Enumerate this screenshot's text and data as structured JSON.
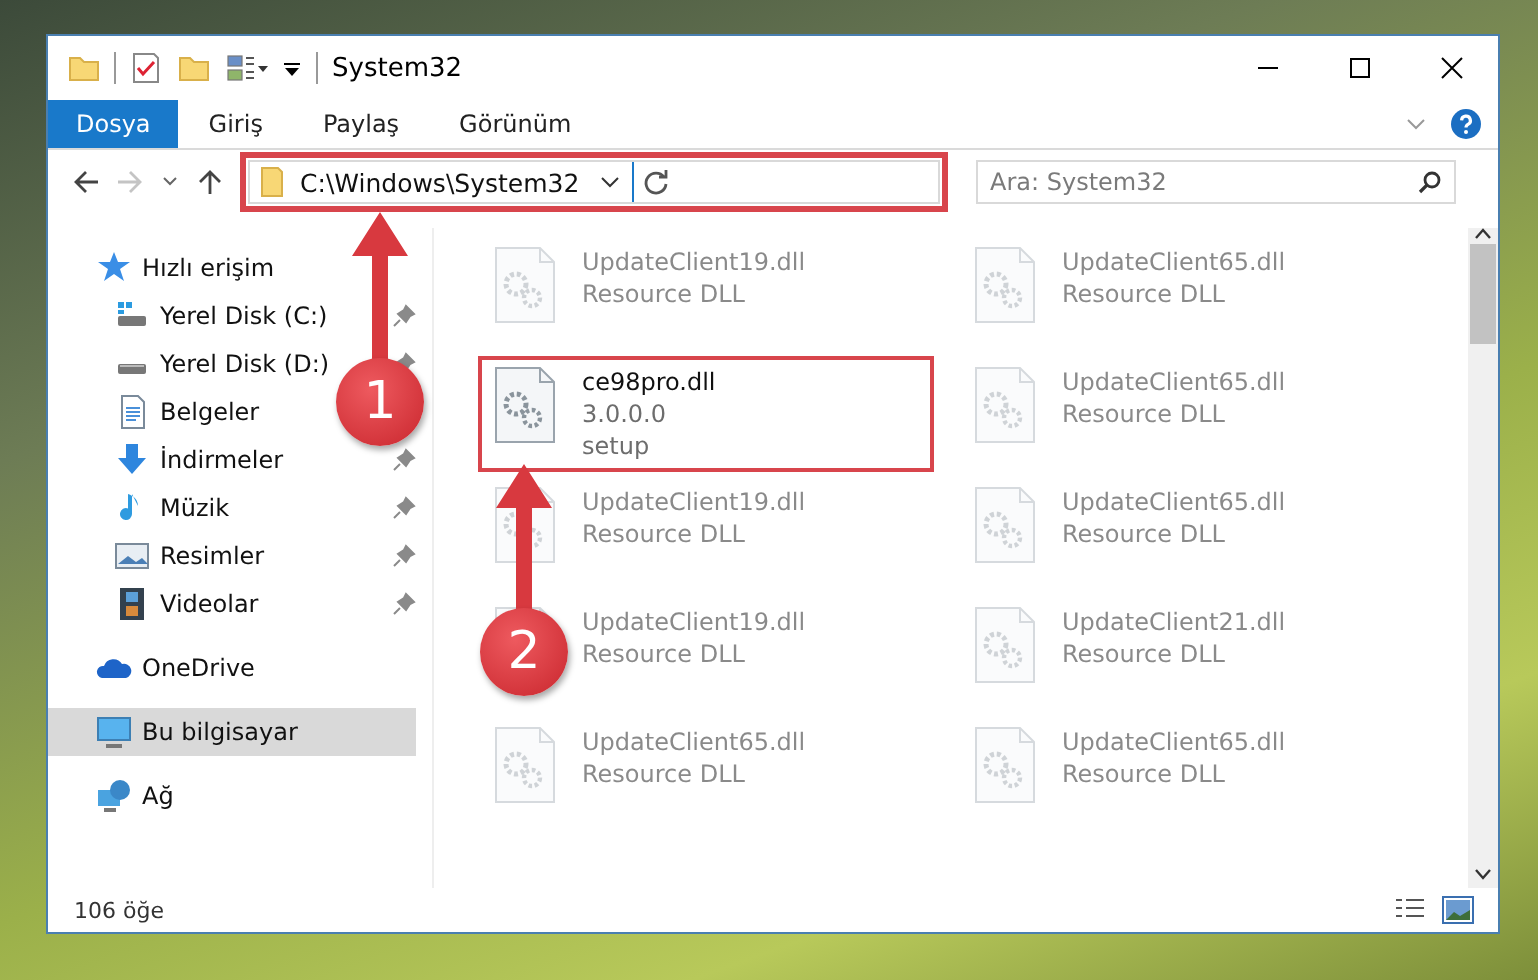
{
  "window": {
    "title": "System32"
  },
  "ribbon": {
    "tabs": [
      {
        "label": "Dosya",
        "selected": true
      },
      {
        "label": "Giriş",
        "selected": false
      },
      {
        "label": "Paylaş",
        "selected": false
      },
      {
        "label": "Görünüm",
        "selected": false
      }
    ]
  },
  "address_bar": {
    "path": "C:\\Windows\\System32",
    "highlighted": true
  },
  "search": {
    "placeholder": "Ara: System32"
  },
  "navigation": {
    "items": [
      {
        "label": "Hızlı erişim",
        "kind": "star",
        "selected": false,
        "children": [
          {
            "label": "Yerel Disk (C:)",
            "kind": "system-drive",
            "selected": false,
            "pinned": true
          },
          {
            "label": "Yerel Disk (D:)",
            "kind": "drive",
            "selected": false,
            "pinned": true
          },
          {
            "label": "Belgeler",
            "kind": "documents",
            "selected": false,
            "pinned": false
          },
          {
            "label": "İndirmeler",
            "kind": "downloads",
            "selected": false,
            "pinned": true
          },
          {
            "label": "Müzik",
            "kind": "music",
            "selected": false,
            "pinned": true
          },
          {
            "label": "Resimler",
            "kind": "pictures",
            "selected": false,
            "pinned": true
          },
          {
            "label": "Videolar",
            "kind": "videos",
            "selected": false,
            "pinned": true
          }
        ]
      },
      {
        "label": "OneDrive",
        "kind": "cloud",
        "selected": false
      },
      {
        "label": "Bu bilgisayar",
        "kind": "computer",
        "selected": true
      },
      {
        "label": "Ağ",
        "kind": "network",
        "selected": false
      }
    ]
  },
  "files": [
    {
      "name": "UpdateClient19.dll",
      "lines": [
        "Resource DLL"
      ],
      "faded": true,
      "highlighted": false
    },
    {
      "name": "UpdateClient65.dll",
      "lines": [
        "Resource DLL"
      ],
      "faded": true,
      "highlighted": false
    },
    {
      "name": "ce98pro.dll",
      "lines": [
        "3.0.0.0",
        "setup"
      ],
      "faded": false,
      "highlighted": true
    },
    {
      "name": "UpdateClient65.dll",
      "lines": [
        "Resource DLL"
      ],
      "faded": true,
      "highlighted": false
    },
    {
      "name": "UpdateClient19.dll",
      "lines": [
        "Resource DLL"
      ],
      "faded": true,
      "highlighted": false
    },
    {
      "name": "UpdateClient65.dll",
      "lines": [
        "Resource DLL"
      ],
      "faded": true,
      "highlighted": false
    },
    {
      "name": "UpdateClient19.dll",
      "lines": [
        "Resource DLL"
      ],
      "faded": true,
      "highlighted": false
    },
    {
      "name": "UpdateClient21.dll",
      "lines": [
        "Resource DLL"
      ],
      "faded": true,
      "highlighted": false
    },
    {
      "name": "UpdateClient65.dll",
      "lines": [
        "Resource DLL"
      ],
      "faded": true,
      "highlighted": false
    },
    {
      "name": "UpdateClient65.dll",
      "lines": [
        "Resource DLL"
      ],
      "faded": true,
      "highlighted": false
    }
  ],
  "status_bar": {
    "count": "106 öğe"
  },
  "callouts": [
    {
      "number": "1"
    },
    {
      "number": "2"
    }
  ]
}
